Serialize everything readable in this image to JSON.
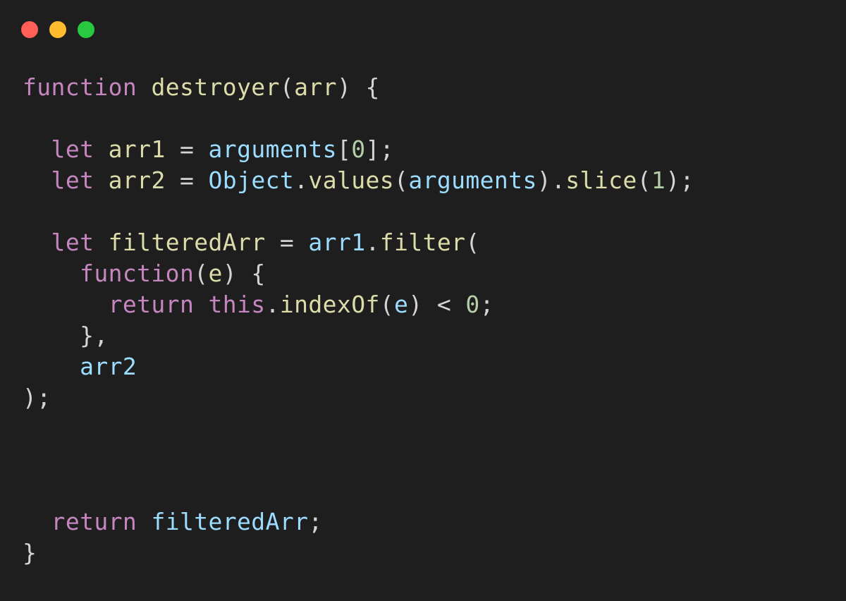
{
  "window": {
    "controls": {
      "close_color": "#ff5f57",
      "minimize_color": "#febc2e",
      "maximize_color": "#28c840"
    }
  },
  "code": {
    "language": "javascript",
    "lines": [
      [
        {
          "t": "function",
          "c": "kw"
        },
        {
          "t": " ",
          "c": "pl"
        },
        {
          "t": "destroyer",
          "c": "fn"
        },
        {
          "t": "(",
          "c": "pl"
        },
        {
          "t": "arr",
          "c": "fn"
        },
        {
          "t": ") {",
          "c": "pl"
        }
      ],
      [],
      [
        {
          "t": "  ",
          "c": "pl"
        },
        {
          "t": "let",
          "c": "kw"
        },
        {
          "t": " ",
          "c": "pl"
        },
        {
          "t": "arr1",
          "c": "fn"
        },
        {
          "t": " = ",
          "c": "pl"
        },
        {
          "t": "arguments",
          "c": "var"
        },
        {
          "t": "[",
          "c": "pl"
        },
        {
          "t": "0",
          "c": "num"
        },
        {
          "t": "];",
          "c": "pl"
        }
      ],
      [
        {
          "t": "  ",
          "c": "pl"
        },
        {
          "t": "let",
          "c": "kw"
        },
        {
          "t": " ",
          "c": "pl"
        },
        {
          "t": "arr2",
          "c": "fn"
        },
        {
          "t": " = ",
          "c": "pl"
        },
        {
          "t": "Object",
          "c": "var"
        },
        {
          "t": ".",
          "c": "pl"
        },
        {
          "t": "values",
          "c": "fn"
        },
        {
          "t": "(",
          "c": "pl"
        },
        {
          "t": "arguments",
          "c": "var"
        },
        {
          "t": ").",
          "c": "pl"
        },
        {
          "t": "slice",
          "c": "fn"
        },
        {
          "t": "(",
          "c": "pl"
        },
        {
          "t": "1",
          "c": "num"
        },
        {
          "t": ");",
          "c": "pl"
        }
      ],
      [],
      [
        {
          "t": "  ",
          "c": "pl"
        },
        {
          "t": "let",
          "c": "kw"
        },
        {
          "t": " ",
          "c": "pl"
        },
        {
          "t": "filteredArr",
          "c": "fn"
        },
        {
          "t": " = ",
          "c": "pl"
        },
        {
          "t": "arr1",
          "c": "var"
        },
        {
          "t": ".",
          "c": "pl"
        },
        {
          "t": "filter",
          "c": "fn"
        },
        {
          "t": "(",
          "c": "pl"
        }
      ],
      [
        {
          "t": "    ",
          "c": "pl"
        },
        {
          "t": "function",
          "c": "kw"
        },
        {
          "t": "(",
          "c": "pl"
        },
        {
          "t": "e",
          "c": "fn"
        },
        {
          "t": ") {",
          "c": "pl"
        }
      ],
      [
        {
          "t": "      ",
          "c": "pl"
        },
        {
          "t": "return",
          "c": "kw"
        },
        {
          "t": " ",
          "c": "pl"
        },
        {
          "t": "this",
          "c": "kw"
        },
        {
          "t": ".",
          "c": "pl"
        },
        {
          "t": "indexOf",
          "c": "fn"
        },
        {
          "t": "(",
          "c": "pl"
        },
        {
          "t": "e",
          "c": "var"
        },
        {
          "t": ") < ",
          "c": "pl"
        },
        {
          "t": "0",
          "c": "num"
        },
        {
          "t": ";",
          "c": "pl"
        }
      ],
      [
        {
          "t": "    },",
          "c": "pl"
        }
      ],
      [
        {
          "t": "    ",
          "c": "pl"
        },
        {
          "t": "arr2",
          "c": "var"
        }
      ],
      [
        {
          "t": ");",
          "c": "pl"
        }
      ],
      [],
      [],
      [],
      [
        {
          "t": "  ",
          "c": "pl"
        },
        {
          "t": "return",
          "c": "kw"
        },
        {
          "t": " ",
          "c": "pl"
        },
        {
          "t": "filteredArr",
          "c": "var"
        },
        {
          "t": ";",
          "c": "pl"
        }
      ],
      [
        {
          "t": "}",
          "c": "pl"
        }
      ]
    ]
  }
}
